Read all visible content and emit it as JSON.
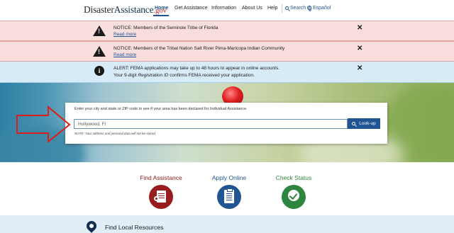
{
  "header": {
    "logo_main": "Disaster",
    "logo_accent": "Assistance",
    "logo_gov": ".gov",
    "nav": [
      "Home",
      "Get Assistance",
      "Information",
      "About Us",
      "Help"
    ],
    "search_label": "Search",
    "language_label": "Español"
  },
  "notices": [
    {
      "text": "NOTICE: Members of the Seminole Tribe of Florida",
      "link": "Read more"
    },
    {
      "text": "NOTICE: Members of the Tribal Nation Salt River Pima-Maricopa Indian Community",
      "link": "Read more"
    }
  ],
  "alert": {
    "line1": "ALERT: FEMA applications may take up to 48 hours to appear in online accounts.",
    "line2_pre": "Your 9-digit ",
    "line2_em": "Registration ID",
    "line2_post": " confirms FEMA received your application."
  },
  "search": {
    "instructions": "Enter your city and state or ZIP code to see if your area has been declared for Individual Assistance.",
    "value": "Hollywood, Fl",
    "button": "Look-up",
    "note": "NOTE: Your address and personal data will not be stored."
  },
  "actions": [
    {
      "label": "Find Assistance"
    },
    {
      "label": "Apply Online"
    },
    {
      "label": "Check Status"
    }
  ],
  "bottom": {
    "label": "Find Local Resources"
  },
  "colors": {
    "primary": "#205493",
    "danger": "#981b1e",
    "success": "#2e8540",
    "notice_bg": "#f9dede",
    "alert_bg": "#d7ebf8"
  }
}
